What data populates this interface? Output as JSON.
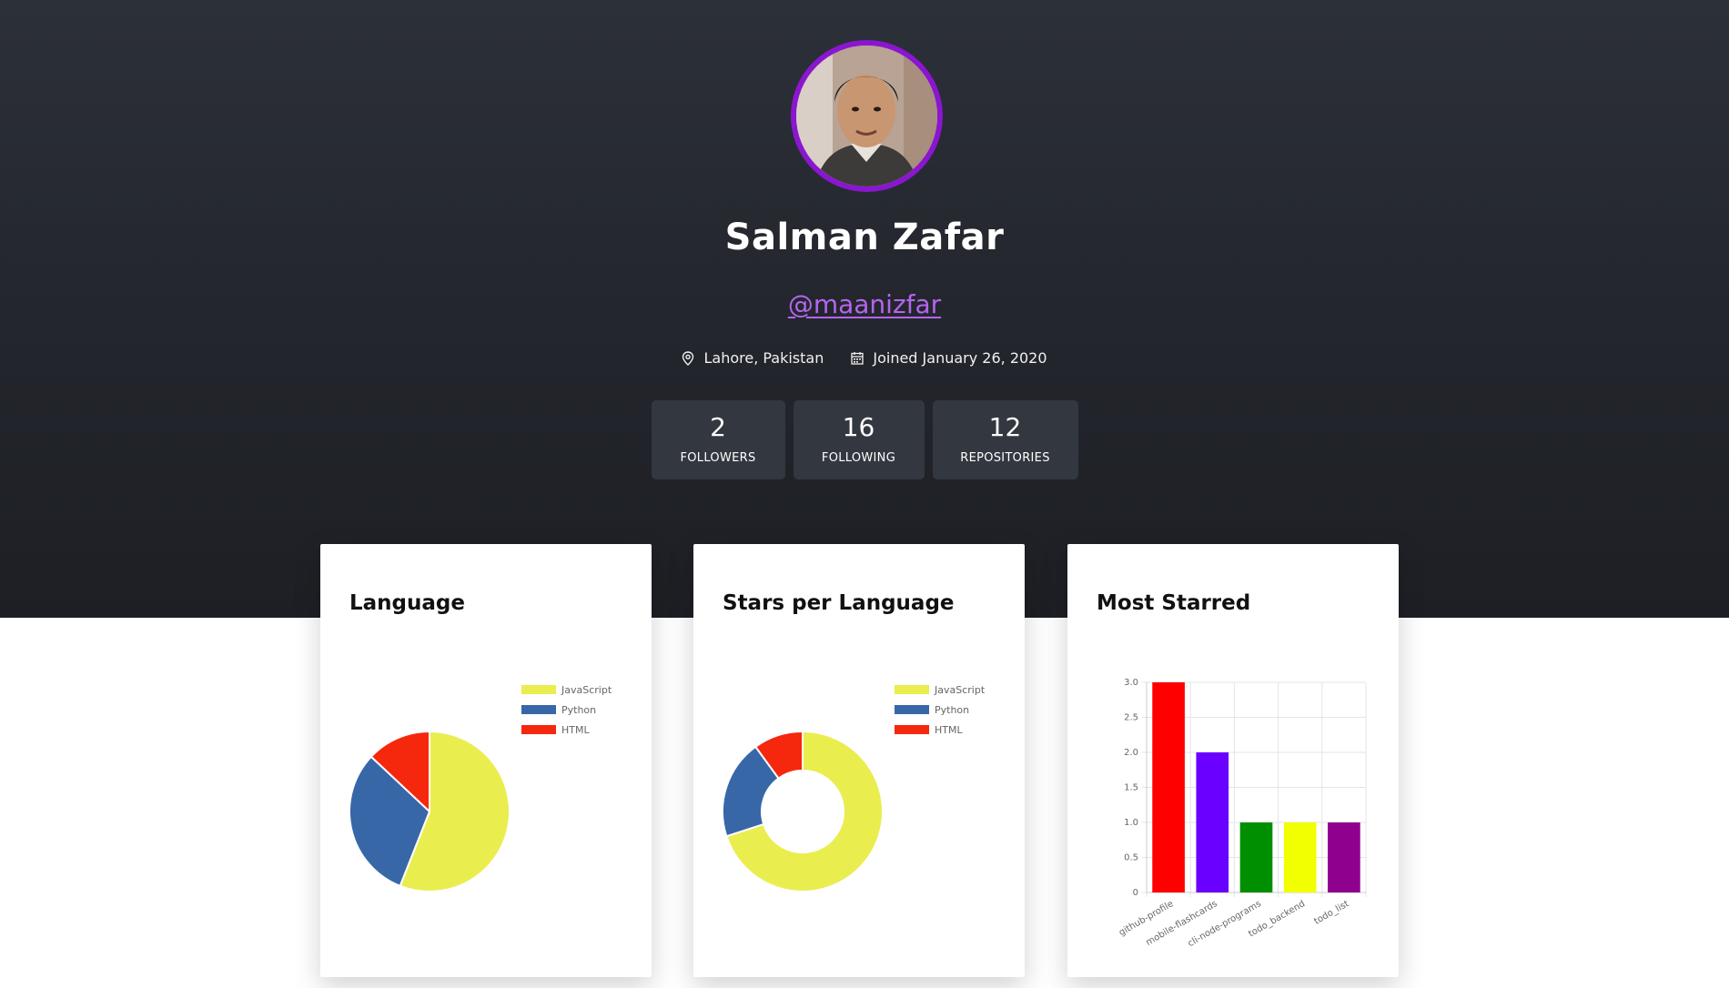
{
  "profile": {
    "name": "Salman Zafar",
    "handle": "@maanizfar",
    "location": "Lahore, Pakistan",
    "joined": "Joined January 26, 2020"
  },
  "stats": [
    {
      "number": "2",
      "label": "FOLLOWERS"
    },
    {
      "number": "16",
      "label": "FOLLOWING"
    },
    {
      "number": "12",
      "label": "REPOSITORIES"
    }
  ],
  "colors": {
    "avatar_ring": "#8a16d0",
    "handle": "#b465f0",
    "javascript": "#eaed4e",
    "python": "#3867a8",
    "html": "#f5270d"
  },
  "cards": {
    "language_title": "Language",
    "stars_title": "Stars per Language",
    "starred_title": "Most Starred"
  },
  "chart_data": [
    {
      "type": "pie",
      "categories": [
        "JavaScript",
        "Python",
        "HTML"
      ],
      "values": [
        56,
        31,
        13
      ],
      "colors": [
        "#eaed4e",
        "#3867a8",
        "#f5270d"
      ],
      "title": "Language",
      "legend": "top-right"
    },
    {
      "type": "pie",
      "categories": [
        "JavaScript",
        "Python",
        "HTML"
      ],
      "values": [
        70,
        20,
        10
      ],
      "colors": [
        "#eaed4e",
        "#3867a8",
        "#f5270d"
      ],
      "title": "Stars per Language",
      "legend": "top-right",
      "donut": true
    },
    {
      "type": "bar",
      "categories": [
        "github-profile",
        "mobile-flashcards",
        "cli-node-programs",
        "todo_backend",
        "todo_list"
      ],
      "values": [
        3,
        2,
        1,
        1,
        1
      ],
      "colors": [
        "#ff0000",
        "#6a00ff",
        "#008f00",
        "#f2ff00",
        "#8f008f"
      ],
      "title": "Most Starred",
      "ylim": [
        0,
        3
      ],
      "yticks": [
        "0",
        "0.5",
        "1.0",
        "1.5",
        "2.0",
        "2.5",
        "3.0"
      ],
      "grid": true
    }
  ]
}
